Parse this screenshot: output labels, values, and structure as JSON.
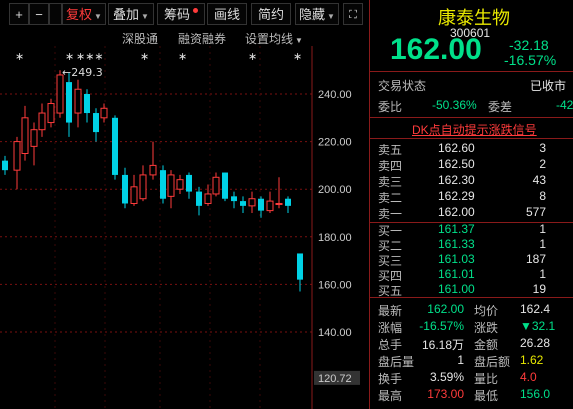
{
  "toolbar": {
    "plus": "+",
    "minus": "−",
    "reset": "□",
    "fq_label": "复权",
    "overlay_label": "叠加",
    "chip_label": "筹码",
    "draw_label": "画线",
    "simple_label": "简约",
    "hide_label": "隐藏"
  },
  "subbar": {
    "sgt": "深股通",
    "margin": "融资融券",
    "ma_label": "设置均线"
  },
  "markers": [
    "∗",
    "∗",
    "∗∗∗",
    "∗",
    "∗",
    "∗",
    "∗",
    "∗",
    "∗"
  ],
  "chart_data": {
    "type": "candlestick",
    "ylim": [
      115,
      260
    ],
    "yticks": [
      240.0,
      220.0,
      200.0,
      180.0,
      160.0,
      140.0,
      120.72
    ],
    "peak_label": "249.3",
    "candles": [
      {
        "o": 212,
        "c": 208,
        "h": 214,
        "l": 206,
        "up": false
      },
      {
        "o": 208,
        "c": 220,
        "h": 222,
        "l": 200,
        "up": true
      },
      {
        "o": 215,
        "c": 230,
        "h": 235,
        "l": 212,
        "up": true
      },
      {
        "o": 218,
        "c": 225,
        "h": 228,
        "l": 210,
        "up": true
      },
      {
        "o": 225,
        "c": 232,
        "h": 236,
        "l": 222,
        "up": true
      },
      {
        "o": 228,
        "c": 236,
        "h": 238,
        "l": 226,
        "up": true
      },
      {
        "o": 232,
        "c": 248,
        "h": 250,
        "l": 230,
        "up": true
      },
      {
        "o": 245,
        "c": 228,
        "h": 249,
        "l": 222,
        "up": false
      },
      {
        "o": 232,
        "c": 242,
        "h": 246,
        "l": 226,
        "up": true
      },
      {
        "o": 240,
        "c": 232,
        "h": 242,
        "l": 228,
        "up": false
      },
      {
        "o": 232,
        "c": 224,
        "h": 234,
        "l": 220,
        "up": false
      },
      {
        "o": 234,
        "c": 230,
        "h": 236,
        "l": 228,
        "up": true
      },
      {
        "o": 230,
        "c": 206,
        "h": 231,
        "l": 204,
        "up": false
      },
      {
        "o": 206,
        "c": 194,
        "h": 209,
        "l": 192,
        "up": false
      },
      {
        "o": 194,
        "c": 201,
        "h": 206,
        "l": 193,
        "up": true
      },
      {
        "o": 196,
        "c": 206,
        "h": 210,
        "l": 195,
        "up": true
      },
      {
        "o": 206,
        "c": 210,
        "h": 220,
        "l": 204,
        "up": true
      },
      {
        "o": 208,
        "c": 196,
        "h": 210,
        "l": 194,
        "up": false
      },
      {
        "o": 197,
        "c": 206,
        "h": 208,
        "l": 192,
        "up": true
      },
      {
        "o": 200,
        "c": 204,
        "h": 206,
        "l": 198,
        "up": true
      },
      {
        "o": 206,
        "c": 199,
        "h": 207,
        "l": 196,
        "up": false
      },
      {
        "o": 199,
        "c": 193,
        "h": 201,
        "l": 189,
        "up": false
      },
      {
        "o": 194,
        "c": 198,
        "h": 202,
        "l": 193,
        "up": true
      },
      {
        "o": 198,
        "c": 205,
        "h": 207,
        "l": 197,
        "up": true
      },
      {
        "o": 207,
        "c": 196,
        "h": 207,
        "l": 195,
        "up": false
      },
      {
        "o": 197,
        "c": 195,
        "h": 199,
        "l": 192,
        "up": false
      },
      {
        "o": 195,
        "c": 193,
        "h": 197,
        "l": 190,
        "up": false
      },
      {
        "o": 193,
        "c": 196,
        "h": 199,
        "l": 190,
        "up": true
      },
      {
        "o": 196,
        "c": 191,
        "h": 197,
        "l": 188,
        "up": false
      },
      {
        "o": 191,
        "c": 195,
        "h": 199,
        "l": 190,
        "up": true
      },
      {
        "o": 194,
        "c": 194,
        "h": 205,
        "l": 192,
        "up": true
      },
      {
        "o": 196,
        "c": 193,
        "h": 197,
        "l": 190,
        "up": false
      },
      {
        "o": 173,
        "c": 162,
        "h": 173,
        "l": 157,
        "up": false
      }
    ]
  },
  "quote": {
    "name": "康泰生物",
    "code": "300601",
    "price": "162.00",
    "change": "-32.18",
    "change_pct": "-16.57%"
  },
  "status": {
    "label": "交易状态",
    "value": "已收市"
  },
  "weibi": {
    "label": "委比",
    "value": "-50.36%",
    "label2": "委差",
    "value2": "-42"
  },
  "dk_label": "DK点自动提示涨跌信号",
  "sells": [
    {
      "label": "卖五",
      "price": "162.60",
      "vol": "3"
    },
    {
      "label": "卖四",
      "price": "162.50",
      "vol": "2"
    },
    {
      "label": "卖三",
      "price": "162.30",
      "vol": "43"
    },
    {
      "label": "卖二",
      "price": "162.29",
      "vol": "8"
    },
    {
      "label": "卖一",
      "price": "162.00",
      "vol": "577"
    }
  ],
  "buys": [
    {
      "label": "买一",
      "price": "161.37",
      "vol": "1"
    },
    {
      "label": "买二",
      "price": "161.33",
      "vol": "1"
    },
    {
      "label": "买三",
      "price": "161.03",
      "vol": "187"
    },
    {
      "label": "买四",
      "price": "161.01",
      "vol": "1"
    },
    {
      "label": "买五",
      "price": "161.00",
      "vol": "19"
    }
  ],
  "stats": [
    {
      "l1": "最新",
      "v1": "162.00",
      "l2": "均价",
      "v2": "162.4"
    },
    {
      "l1": "涨幅",
      "v1": "-16.57%",
      "l2": "涨跌",
      "v2": "▼32.1"
    },
    {
      "l1": "总手",
      "v1": "16.18万",
      "l2": "金额",
      "v2": "26.28"
    },
    {
      "l1": "盘后量",
      "v1": "1",
      "l2": "盘后额",
      "v2": "1.62"
    },
    {
      "l1": "换手",
      "v1": "3.59%",
      "l2": "量比",
      "v2": "4.0"
    },
    {
      "l1": "最高",
      "v1": "173.00",
      "l2": "最低",
      "v2": "156.0"
    }
  ],
  "colors": {
    "up": "#ff3b3b",
    "down": "#00d2e6",
    "border": "#8a1a1a"
  }
}
